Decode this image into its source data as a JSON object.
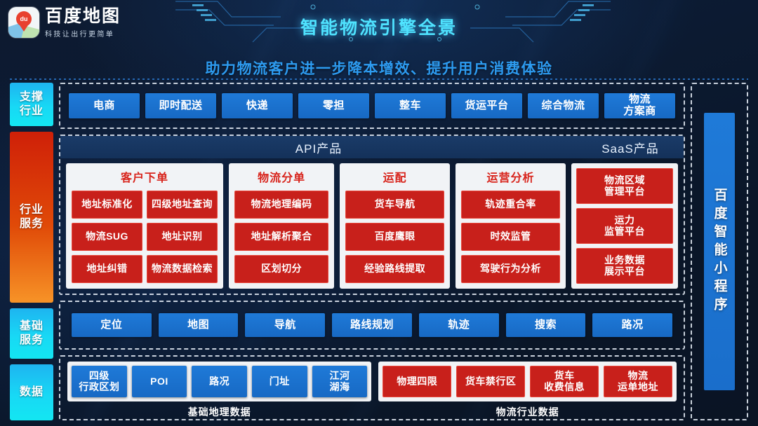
{
  "brand": {
    "name": "百度地图",
    "slogan": "科技让出行更简单",
    "mark_text": "du"
  },
  "header": {
    "title": "智能物流引擎全景",
    "subtitle": "助力物流客户进一步降本增效、提升用户消费体验"
  },
  "colors": {
    "accent_cyan": "#4fe3ff",
    "accent_blue": "#1f7ad8",
    "accent_red": "#c8201b",
    "rail_red_from": "#cf2008",
    "rail_red_to": "#f79327",
    "background": "#0c1b33"
  },
  "rail": {
    "support": "支撑\n行业",
    "support_l1": "支撑",
    "support_l2": "行业",
    "service_l1": "行业",
    "service_l2": "服务",
    "base_l1": "基础",
    "base_l2": "服务",
    "data_l1": "数据"
  },
  "support_industries": [
    {
      "label": "电商"
    },
    {
      "label": "即时配送"
    },
    {
      "label": "快递"
    },
    {
      "label": "零担"
    },
    {
      "label": "整车"
    },
    {
      "label": "货运平台"
    },
    {
      "label": "综合物流"
    },
    {
      "label": "物流\n方案商",
      "l1": "物流",
      "l2": "方案商"
    }
  ],
  "industry_service": {
    "api_header": "API产品",
    "saas_header": "SaaS产品",
    "api_cards": [
      {
        "title": "客户下单",
        "columns": [
          [
            "地址标准化",
            "物流SUG",
            "地址纠错"
          ],
          [
            "四级地址查询",
            "地址识别",
            "物流数据检索"
          ]
        ]
      },
      {
        "title": "物流分单",
        "columns": [
          [
            "物流地理编码",
            "地址解析聚合",
            "区划切分"
          ]
        ]
      },
      {
        "title": "运配",
        "columns": [
          [
            "货车导航",
            "百度鹰眼",
            "经验路线提取"
          ]
        ]
      },
      {
        "title": "运营分析",
        "columns": [
          [
            "轨迹重合率",
            "时效监管",
            "驾驶行为分析"
          ]
        ]
      }
    ],
    "saas_items": [
      {
        "l1": "物流区域",
        "l2": "管理平台"
      },
      {
        "l1": "运力",
        "l2": "监管平台"
      },
      {
        "l1": "业务数据",
        "l2": "展示平台"
      }
    ]
  },
  "base_services": [
    {
      "label": "定位"
    },
    {
      "label": "地图"
    },
    {
      "label": "导航"
    },
    {
      "label": "路线规划"
    },
    {
      "label": "轨迹"
    },
    {
      "label": "搜索"
    },
    {
      "label": "路况"
    }
  ],
  "data_section": {
    "geo": {
      "caption": "基础地理数据",
      "items": [
        {
          "l1": "四级",
          "l2": "行政区划"
        },
        {
          "l1": "POI",
          "l2": ""
        },
        {
          "l1": "路况",
          "l2": ""
        },
        {
          "l1": "门址",
          "l2": ""
        },
        {
          "l1": "江河",
          "l2": "湖海"
        }
      ]
    },
    "logistics": {
      "caption": "物流行业数据",
      "items": [
        {
          "l1": "物理四限",
          "l2": ""
        },
        {
          "l1": "货车禁行区",
          "l2": ""
        },
        {
          "l1": "货车",
          "l2": "收费信息"
        },
        {
          "l1": "物流",
          "l2": "运单地址"
        }
      ]
    }
  },
  "mini_program": {
    "label": "百度智能小程序"
  }
}
